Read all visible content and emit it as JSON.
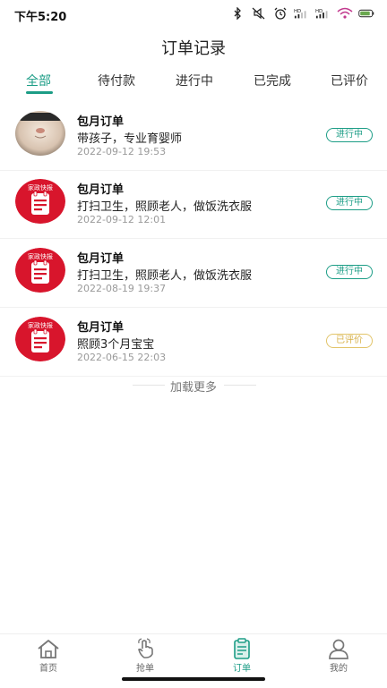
{
  "status": {
    "time": "下午5:20"
  },
  "page": {
    "title": "订单记录"
  },
  "tabs": [
    "全部",
    "待付款",
    "进行中",
    "已完成",
    "已评价"
  ],
  "orders": [
    {
      "title": "包月订单",
      "desc": "带孩子，专业育婴师",
      "date": "2022-09-12 19:53",
      "status": "进行中",
      "thumb": "photo"
    },
    {
      "title": "包月订单",
      "desc": "打扫卫生，照顾老人，做饭洗衣服",
      "date": "2022-09-12 12:01",
      "status": "进行中",
      "thumb": "logo"
    },
    {
      "title": "包月订单",
      "desc": "打扫卫生，照顾老人，做饭洗衣服",
      "date": "2022-08-19 19:37",
      "status": "进行中",
      "thumb": "logo"
    },
    {
      "title": "包月订单",
      "desc": "照顾3个月宝宝",
      "date": "2022-06-15 22:03",
      "status": "已评价",
      "thumb": "logo"
    }
  ],
  "logo_text": "家政快报",
  "load_more": "加载更多",
  "bottom_nav": [
    "首页",
    "抢单",
    "订单",
    "我的"
  ],
  "colors": {
    "accent": "#1c9d86",
    "rated": "#d7b14a",
    "logo_red": "#d8152c"
  }
}
